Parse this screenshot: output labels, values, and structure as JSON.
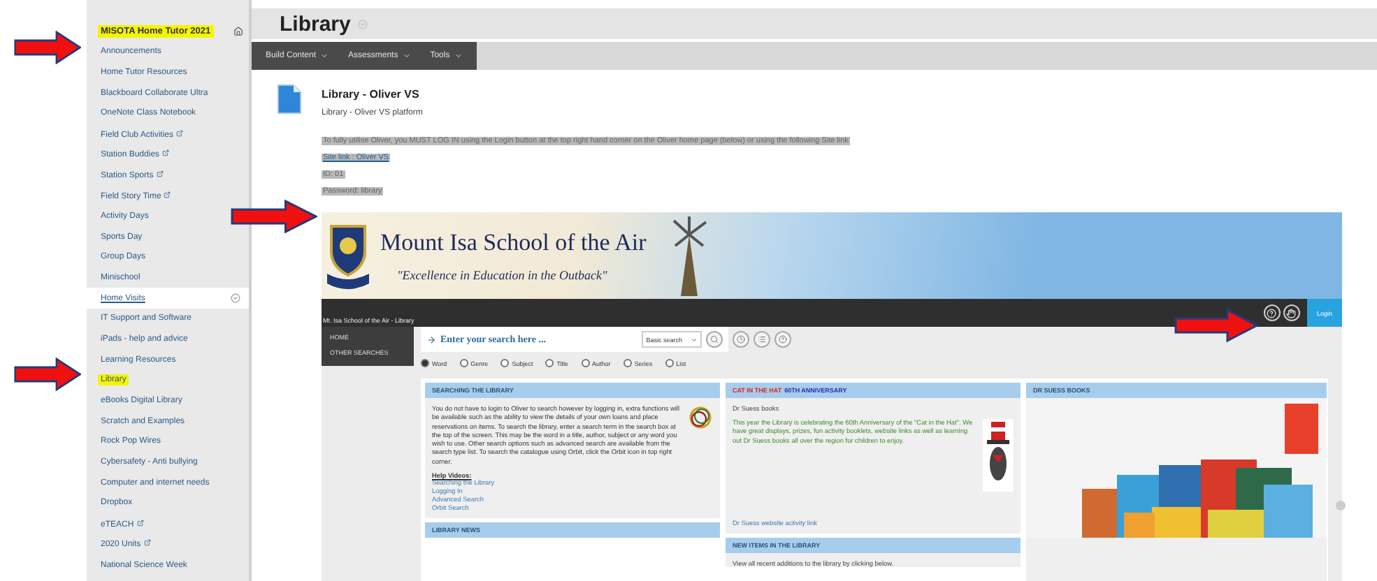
{
  "sidebar": {
    "course_title": "MISOTA Home Tutor 2021",
    "course_highlighted": true,
    "items": [
      {
        "label": "Announcements",
        "highlighted": false,
        "hovered": false,
        "external": false
      },
      {
        "label": "Home Tutor Resources",
        "highlighted": false,
        "hovered": false,
        "external": false
      },
      {
        "label": "Blackboard Collaborate Ultra",
        "highlighted": false,
        "hovered": false,
        "external": false
      },
      {
        "label": "OneNote Class Notebook",
        "highlighted": false,
        "hovered": false,
        "external": false
      },
      {
        "label": "Field Club Activities",
        "highlighted": false,
        "hovered": false,
        "external": true
      },
      {
        "label": "Station Buddies",
        "highlighted": false,
        "hovered": false,
        "external": true
      },
      {
        "label": "Station Sports",
        "highlighted": false,
        "hovered": false,
        "external": true
      },
      {
        "label": "Field Story Time",
        "highlighted": false,
        "hovered": false,
        "external": true
      },
      {
        "label": "Activity Days",
        "highlighted": false,
        "hovered": false,
        "external": false
      },
      {
        "label": "Sports Day",
        "highlighted": false,
        "hovered": false,
        "external": false
      },
      {
        "label": "Group Days",
        "highlighted": false,
        "hovered": false,
        "external": false
      },
      {
        "label": "Minischool",
        "highlighted": false,
        "hovered": false,
        "external": false
      },
      {
        "label": "Home Visits",
        "highlighted": false,
        "hovered": true,
        "external": false
      },
      {
        "label": "IT Support and Software",
        "highlighted": false,
        "hovered": false,
        "external": false
      },
      {
        "label": "iPads - help and advice",
        "highlighted": false,
        "hovered": false,
        "external": false
      },
      {
        "label": "Learning Resources",
        "highlighted": false,
        "hovered": false,
        "external": false
      },
      {
        "label": "Library",
        "highlighted": true,
        "hovered": false,
        "external": false
      },
      {
        "label": "eBooks Digital Library",
        "highlighted": false,
        "hovered": false,
        "external": false
      },
      {
        "label": "Scratch and Examples",
        "highlighted": false,
        "hovered": false,
        "external": false
      },
      {
        "label": "Rock Pop Wires",
        "highlighted": false,
        "hovered": false,
        "external": false
      },
      {
        "label": "Cybersafety - Anti bullying",
        "highlighted": false,
        "hovered": false,
        "external": false
      },
      {
        "label": "Computer and internet needs",
        "highlighted": false,
        "hovered": false,
        "external": false
      },
      {
        "label": "Dropbox",
        "highlighted": false,
        "hovered": false,
        "external": false
      },
      {
        "label": "eTEACH",
        "highlighted": false,
        "hovered": false,
        "external": true
      },
      {
        "label": "2020 Units",
        "highlighted": false,
        "hovered": false,
        "external": true
      },
      {
        "label": "National Science Week",
        "highlighted": false,
        "hovered": false,
        "external": false
      }
    ]
  },
  "page": {
    "title": "Library",
    "toolbar": [
      "Build Content",
      "Assessments",
      "Tools"
    ]
  },
  "content_item": {
    "title": "Library - Oliver VS",
    "description": "Library - Oliver VS platform",
    "lines": [
      {
        "text": "To fully utilise Oliver, you MUST LOG IN using the Login button at the top right hand corner on the Oliver home page (below) or using the following Site link",
        "link": false
      },
      {
        "text": "Site link : Oliver VS",
        "link": true
      },
      {
        "text": "ID: 01",
        "link": false
      },
      {
        "text": "Password: library",
        "link": false
      }
    ]
  },
  "library_site": {
    "school": "Mount Isa School of the Air",
    "motto": "\"Excellence in Education in the Outback\"",
    "breadcrumb": "Mt. Isa School of the Air - Library",
    "login": "Login",
    "nav": [
      "HOME",
      "OTHER SEARCHES"
    ],
    "search": {
      "placeholder": "Enter your search here ...",
      "type": "Basic search"
    },
    "search_options": [
      {
        "label": "Word",
        "selected": true
      },
      {
        "label": "Genre",
        "selected": false
      },
      {
        "label": "Subject",
        "selected": false
      },
      {
        "label": "Title",
        "selected": false
      },
      {
        "label": "Author",
        "selected": false
      },
      {
        "label": "Series",
        "selected": false
      },
      {
        "label": "List",
        "selected": false
      }
    ],
    "searching": {
      "title": "SEARCHING THE LIBRARY",
      "text": "You do not have to login to Oliver to search however by logging in, extra functions will be available such as the ability to view the details of your own loans and place reservations on items.  To search the library, enter a search term in the search box at the top of the screen.  This may be the word in a title, author, subject or any word you wish to use.  Other search options such as advanced search are available from the search type list.  To search the catalogue using Orbit, click the Orbit icon in top right corner.",
      "help_title": "Help Videos:",
      "links": [
        "Searching the Library",
        "Logging In",
        "Advanced Search",
        "Orbit Search"
      ]
    },
    "news": {
      "title": "LIBRARY NEWS"
    },
    "anniversary": {
      "title": "CAT IN THE HAT",
      "title_suffix": "60TH ANNIVERSARY",
      "subtitle": "Dr Suess books",
      "text": "This year the Library is celebrating the 60th Anniversary of the \"Cat in the Hat\".  We have great displays, prizes, fun activity booklets, website links as well as learning out Dr Suess books all over the region for children to enjoy.",
      "link": "Dr Suess website activity link"
    },
    "new_items": {
      "title": "NEW ITEMS IN THE LIBRARY",
      "text": "View all recent additions to the library by clicking below."
    },
    "books": {
      "title": "DR SUESS BOOKS"
    }
  }
}
